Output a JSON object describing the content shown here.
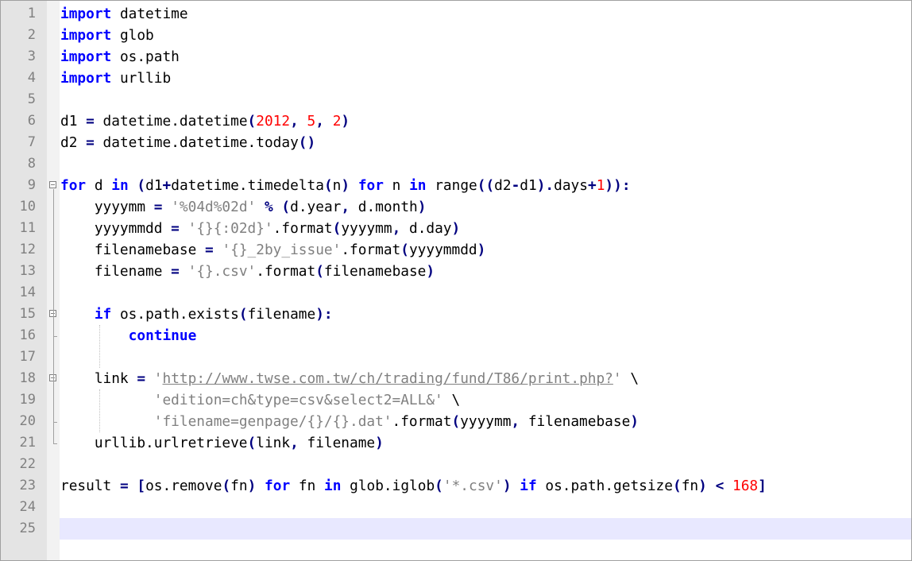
{
  "editor": {
    "lines": [
      {
        "n": "1",
        "tokens": [
          {
            "t": "import",
            "c": "kw"
          },
          {
            "t": " datetime"
          }
        ]
      },
      {
        "n": "2",
        "tokens": [
          {
            "t": "import",
            "c": "kw"
          },
          {
            "t": " glob"
          }
        ]
      },
      {
        "n": "3",
        "tokens": [
          {
            "t": "import",
            "c": "kw"
          },
          {
            "t": " os.path"
          }
        ]
      },
      {
        "n": "4",
        "tokens": [
          {
            "t": "import",
            "c": "kw"
          },
          {
            "t": " urllib"
          }
        ]
      },
      {
        "n": "5",
        "tokens": []
      },
      {
        "n": "6",
        "tokens": [
          {
            "t": "d1 "
          },
          {
            "t": "=",
            "c": "op"
          },
          {
            "t": " datetime.datetime"
          },
          {
            "t": "(",
            "c": "op"
          },
          {
            "t": "2012",
            "c": "num"
          },
          {
            "t": ",",
            "c": "op"
          },
          {
            "t": " "
          },
          {
            "t": "5",
            "c": "num"
          },
          {
            "t": ",",
            "c": "op"
          },
          {
            "t": " "
          },
          {
            "t": "2",
            "c": "num"
          },
          {
            "t": ")",
            "c": "op"
          }
        ]
      },
      {
        "n": "7",
        "tokens": [
          {
            "t": "d2 "
          },
          {
            "t": "=",
            "c": "op"
          },
          {
            "t": " datetime.datetime.today"
          },
          {
            "t": "()",
            "c": "op"
          }
        ]
      },
      {
        "n": "8",
        "tokens": []
      },
      {
        "n": "9",
        "tokens": [
          {
            "t": "for",
            "c": "kw"
          },
          {
            "t": " d "
          },
          {
            "t": "in",
            "c": "kw"
          },
          {
            "t": " "
          },
          {
            "t": "(",
            "c": "op"
          },
          {
            "t": "d1"
          },
          {
            "t": "+",
            "c": "op"
          },
          {
            "t": "datetime.timedelta"
          },
          {
            "t": "(",
            "c": "op"
          },
          {
            "t": "n"
          },
          {
            "t": ")",
            "c": "op"
          },
          {
            "t": " "
          },
          {
            "t": "for",
            "c": "kw"
          },
          {
            "t": " n "
          },
          {
            "t": "in",
            "c": "kw"
          },
          {
            "t": " range"
          },
          {
            "t": "((",
            "c": "op"
          },
          {
            "t": "d2"
          },
          {
            "t": "-",
            "c": "op"
          },
          {
            "t": "d1"
          },
          {
            "t": ").",
            "c": "op"
          },
          {
            "t": "days"
          },
          {
            "t": "+",
            "c": "op"
          },
          {
            "t": "1",
            "c": "num"
          },
          {
            "t": ")):",
            "c": "op"
          }
        ]
      },
      {
        "n": "10",
        "tokens": [
          {
            "t": "    yyyymm "
          },
          {
            "t": "=",
            "c": "op"
          },
          {
            "t": " "
          },
          {
            "t": "'%04d%02d'",
            "c": "str"
          },
          {
            "t": " "
          },
          {
            "t": "%",
            "c": "op"
          },
          {
            "t": " "
          },
          {
            "t": "(",
            "c": "op"
          },
          {
            "t": "d.year"
          },
          {
            "t": ",",
            "c": "op"
          },
          {
            "t": " d.month"
          },
          {
            "t": ")",
            "c": "op"
          }
        ]
      },
      {
        "n": "11",
        "tokens": [
          {
            "t": "    yyyymmdd "
          },
          {
            "t": "=",
            "c": "op"
          },
          {
            "t": " "
          },
          {
            "t": "'{}{:02d}'",
            "c": "str"
          },
          {
            "t": ".format"
          },
          {
            "t": "(",
            "c": "op"
          },
          {
            "t": "yyyymm"
          },
          {
            "t": ",",
            "c": "op"
          },
          {
            "t": " d.day"
          },
          {
            "t": ")",
            "c": "op"
          }
        ]
      },
      {
        "n": "12",
        "tokens": [
          {
            "t": "    filenamebase "
          },
          {
            "t": "=",
            "c": "op"
          },
          {
            "t": " "
          },
          {
            "t": "'{}_2by_issue'",
            "c": "str"
          },
          {
            "t": ".format"
          },
          {
            "t": "(",
            "c": "op"
          },
          {
            "t": "yyyymmdd"
          },
          {
            "t": ")",
            "c": "op"
          }
        ]
      },
      {
        "n": "13",
        "tokens": [
          {
            "t": "    filename "
          },
          {
            "t": "=",
            "c": "op"
          },
          {
            "t": " "
          },
          {
            "t": "'{}.csv'",
            "c": "str"
          },
          {
            "t": ".format"
          },
          {
            "t": "(",
            "c": "op"
          },
          {
            "t": "filenamebase"
          },
          {
            "t": ")",
            "c": "op"
          }
        ]
      },
      {
        "n": "14",
        "tokens": []
      },
      {
        "n": "15",
        "tokens": [
          {
            "t": "    "
          },
          {
            "t": "if",
            "c": "kw"
          },
          {
            "t": " os.path.exists"
          },
          {
            "t": "(",
            "c": "op"
          },
          {
            "t": "filename"
          },
          {
            "t": "):",
            "c": "op"
          }
        ]
      },
      {
        "n": "16",
        "tokens": [
          {
            "t": "        "
          },
          {
            "t": "continue",
            "c": "kw"
          }
        ]
      },
      {
        "n": "17",
        "tokens": []
      },
      {
        "n": "18",
        "tokens": [
          {
            "t": "    link "
          },
          {
            "t": "=",
            "c": "op"
          },
          {
            "t": " "
          },
          {
            "t": "'",
            "c": "str"
          },
          {
            "t": "http://www.twse.com.tw/ch/trading/fund/T86/print.php?",
            "c": "str url"
          },
          {
            "t": "'",
            "c": "str"
          },
          {
            "t": " \\"
          }
        ]
      },
      {
        "n": "19",
        "tokens": [
          {
            "t": "           "
          },
          {
            "t": "'edition=ch&type=csv&select2=ALL&'",
            "c": "str"
          },
          {
            "t": " \\"
          }
        ]
      },
      {
        "n": "20",
        "tokens": [
          {
            "t": "           "
          },
          {
            "t": "'filename=genpage/{}/{}.dat'",
            "c": "str"
          },
          {
            "t": ".format"
          },
          {
            "t": "(",
            "c": "op"
          },
          {
            "t": "yyyymm"
          },
          {
            "t": ",",
            "c": "op"
          },
          {
            "t": " filenamebase"
          },
          {
            "t": ")",
            "c": "op"
          }
        ]
      },
      {
        "n": "21",
        "tokens": [
          {
            "t": "    urllib.urlretrieve"
          },
          {
            "t": "(",
            "c": "op"
          },
          {
            "t": "link"
          },
          {
            "t": ",",
            "c": "op"
          },
          {
            "t": " filename"
          },
          {
            "t": ")",
            "c": "op"
          }
        ]
      },
      {
        "n": "22",
        "tokens": []
      },
      {
        "n": "23",
        "tokens": [
          {
            "t": "result "
          },
          {
            "t": "=",
            "c": "op"
          },
          {
            "t": " "
          },
          {
            "t": "[",
            "c": "op"
          },
          {
            "t": "os.remove"
          },
          {
            "t": "(",
            "c": "op"
          },
          {
            "t": "fn"
          },
          {
            "t": ")",
            "c": "op"
          },
          {
            "t": " "
          },
          {
            "t": "for",
            "c": "kw"
          },
          {
            "t": " fn "
          },
          {
            "t": "in",
            "c": "kw"
          },
          {
            "t": " glob.iglob"
          },
          {
            "t": "(",
            "c": "op"
          },
          {
            "t": "'*.csv'",
            "c": "str"
          },
          {
            "t": ")",
            "c": "op"
          },
          {
            "t": " "
          },
          {
            "t": "if",
            "c": "kw"
          },
          {
            "t": " os.path.getsize"
          },
          {
            "t": "(",
            "c": "op"
          },
          {
            "t": "fn"
          },
          {
            "t": ")",
            "c": "op"
          },
          {
            "t": " "
          },
          {
            "t": "<",
            "c": "op"
          },
          {
            "t": " "
          },
          {
            "t": "168",
            "c": "num"
          },
          {
            "t": "]",
            "c": "op"
          }
        ]
      },
      {
        "n": "24",
        "tokens": []
      },
      {
        "n": "25",
        "tokens": []
      }
    ],
    "current_line": "25",
    "fold_markers": [
      "9",
      "15",
      "18"
    ],
    "colors": {
      "keyword": "#0000ff",
      "number": "#ff0000",
      "string": "#808080",
      "operator": "#000080",
      "current_line": "#e8e8ff",
      "gutter": "#e4e4e4"
    }
  }
}
